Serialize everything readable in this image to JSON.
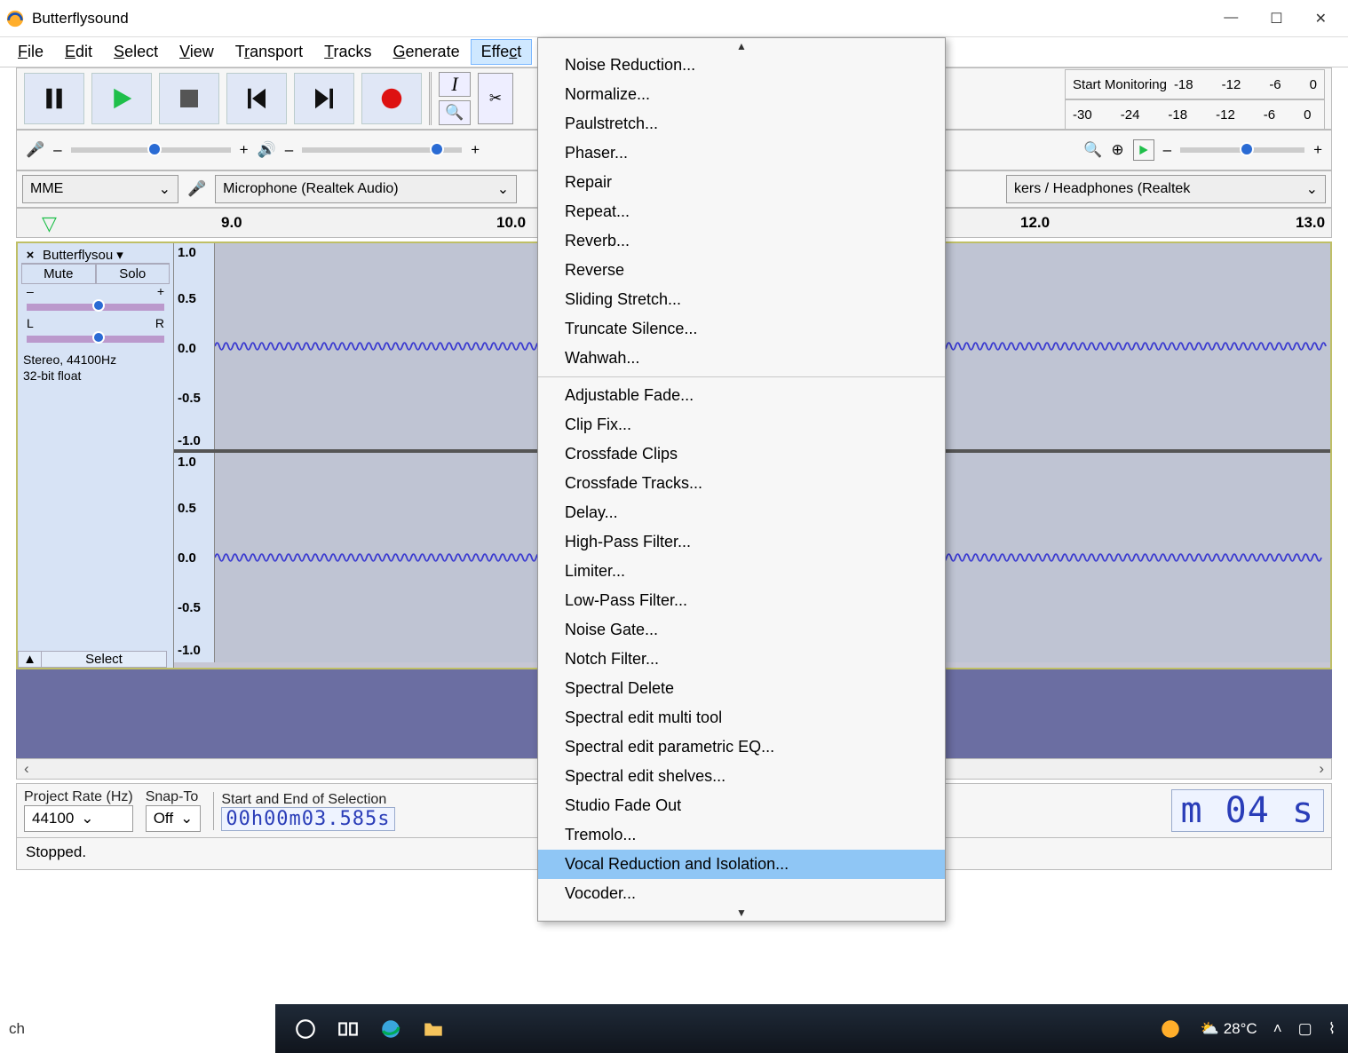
{
  "window": {
    "title": "Butterflysound"
  },
  "menus": {
    "file": "File",
    "edit": "Edit",
    "select": "Select",
    "view": "View",
    "transport": "Transport",
    "tracks": "Tracks",
    "generate": "Generate",
    "effect": "Effect"
  },
  "meters": {
    "rec_label": "Start Monitoring",
    "rec_ticks": [
      "-18",
      "-12",
      "-6",
      "0"
    ],
    "play_ticks": [
      "-30",
      "-24",
      "-18",
      "-12",
      "-6",
      "0"
    ]
  },
  "devices": {
    "host": "MME",
    "input": "Microphone (Realtek Audio)",
    "output": "kers / Headphones (Realtek"
  },
  "ruler": {
    "t0": "9.0",
    "t1": "10.0",
    "t2": "12.0",
    "t3": "13.0"
  },
  "track": {
    "name": "Butterflysou",
    "mute": "Mute",
    "solo": "Solo",
    "info1": "Stereo, 44100Hz",
    "info2": "32-bit float",
    "select": "Select",
    "amps": [
      "1.0",
      "0.5",
      "0.0",
      "-0.5",
      "-1.0"
    ]
  },
  "selection": {
    "rate_label": "Project Rate (Hz)",
    "snap_label": "Snap-To",
    "range_label": "Start and End of Selection",
    "rate_value": "44100",
    "snap_value": "Off",
    "start": "00h00m03.585s",
    "big": "m 04 s"
  },
  "status": {
    "text": "Stopped."
  },
  "taskbar": {
    "search": "ch",
    "temp": "28°C"
  },
  "hscroll": {
    "left": "‹",
    "right": "›"
  },
  "effect_menu": {
    "highlighted": "Vocal Reduction and Isolation...",
    "groups": [
      [
        "Noise Reduction...",
        "Normalize...",
        "Paulstretch...",
        "Phaser...",
        "Repair",
        "Repeat...",
        "Reverb...",
        "Reverse",
        "Sliding Stretch...",
        "Truncate Silence...",
        "Wahwah..."
      ],
      [
        "Adjustable Fade...",
        "Clip Fix...",
        "Crossfade Clips",
        "Crossfade Tracks...",
        "Delay...",
        "High-Pass Filter...",
        "Limiter...",
        "Low-Pass Filter...",
        "Noise Gate...",
        "Notch Filter...",
        "Spectral Delete",
        "Spectral edit multi tool",
        "Spectral edit parametric EQ...",
        "Spectral edit shelves...",
        "Studio Fade Out",
        "Tremolo...",
        "Vocal Reduction and Isolation...",
        "Vocoder..."
      ]
    ]
  }
}
